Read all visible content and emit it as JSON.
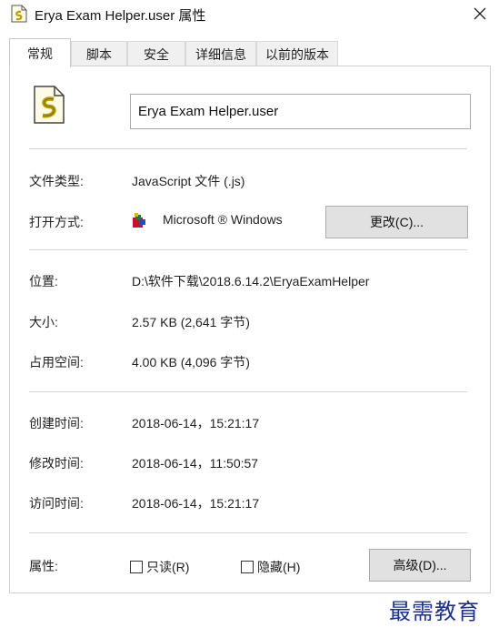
{
  "window": {
    "title": "Erya Exam Helper.user 属性"
  },
  "tabs": [
    {
      "label": "常规",
      "active": true
    },
    {
      "label": "脚本",
      "active": false
    },
    {
      "label": "安全",
      "active": false
    },
    {
      "label": "详细信息",
      "active": false
    },
    {
      "label": "以前的版本",
      "active": false
    }
  ],
  "general": {
    "file_name": "Erya Exam Helper.user",
    "file_type_label": "文件类型:",
    "file_type_value": "JavaScript 文件 (.js)",
    "opens_with_label": "打开方式:",
    "opens_with_value": "Microsoft ® Windows",
    "change_button": "更改(C)...",
    "location_label": "位置:",
    "location_value": "D:\\软件下载\\2018.6.14.2\\EryaExamHelper",
    "size_label": "大小:",
    "size_value": "2.57 KB (2,641 字节)",
    "size_on_disk_label": "占用空间:",
    "size_on_disk_value": "4.00 KB (4,096 字节)",
    "created_label": "创建时间:",
    "created_value": "2018-06-14，15:21:17",
    "modified_label": "修改时间:",
    "modified_value": "2018-06-14，11:50:57",
    "accessed_label": "访问时间:",
    "accessed_value": "2018-06-14，15:21:17",
    "attributes_label": "属性:",
    "readonly_label": "只读(R)",
    "readonly_checked": false,
    "hidden_label": "隐藏(H)",
    "hidden_checked": false,
    "advanced_button": "高级(D)..."
  },
  "watermark": "最需教育",
  "icons": {
    "title": "script-file-icon",
    "file": "script-file-icon",
    "app": "windows-script-host-icon",
    "close": "close-icon"
  },
  "colors": {
    "watermark": "#1d2f8f",
    "button_bg": "#e1e1e1",
    "separator": "#d6d6d6"
  }
}
